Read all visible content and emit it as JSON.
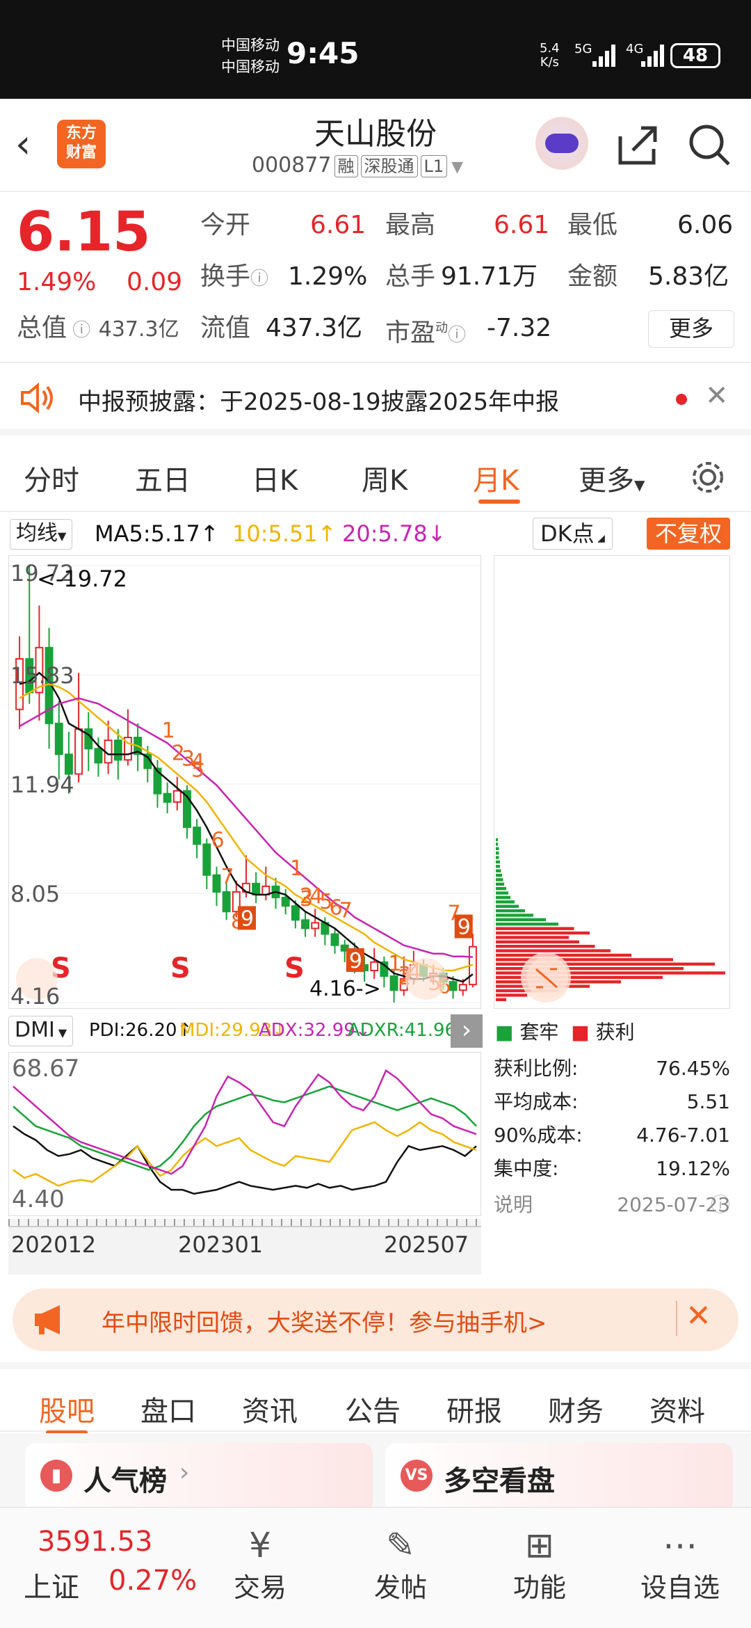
{
  "status": {
    "carrier1": "中国移动",
    "carrier2": "中国移动",
    "time": "9:45",
    "net_speed": "5.4",
    "net_unit": "K/s",
    "sig1": "5G",
    "sig2": "4G",
    "battery": "48"
  },
  "header": {
    "logo_line1": "东方",
    "logo_line2": "财富",
    "name": "天山股份",
    "code": "000877",
    "tags": [
      "融",
      "深股通",
      "L1"
    ]
  },
  "quote": {
    "price": "6.15",
    "pct": "1.49%",
    "chg": "0.09",
    "open_label": "今开",
    "open": "6.61",
    "high_label": "最高",
    "high": "6.61",
    "low_label": "最低",
    "low": "6.06",
    "turn_label": "换手",
    "turn": "1.29%",
    "vol_label": "总手",
    "vol": "91.71万",
    "amt_label": "金额",
    "amt": "5.83亿",
    "cap_label": "总值",
    "cap": "437.3亿",
    "float_label": "流值",
    "float": "437.3亿",
    "pe_label": "市盈",
    "pe_sup": "动",
    "pe": "-7.32",
    "more": "更多"
  },
  "notice": {
    "text": "中报预披露：于2025-08-19披露2025年中报"
  },
  "periods": {
    "items": [
      "分时",
      "五日",
      "日K",
      "周K",
      "月K",
      "更多"
    ],
    "active": "月K"
  },
  "chartbar": {
    "ma_select": "均线",
    "ma5": "MA5:5.17↑",
    "ma10": "10:5.51↑",
    "ma20": "20:5.78↓",
    "dk": "DK点",
    "fq": "不复权"
  },
  "chart_data": {
    "type": "candlestick",
    "y_ticks": [
      "19.72",
      "15.83",
      "11.94",
      "8.05",
      "4.16"
    ],
    "max_label": "<-19.72",
    "min_label": "4.16->",
    "ylim": [
      4.16,
      19.72
    ],
    "x_labels": [
      "202012",
      "202301",
      "202507"
    ],
    "candles": [
      [
        14.6,
        16.4,
        17.2,
        13.9
      ],
      [
        16.4,
        15.2,
        19.72,
        14.8
      ],
      [
        15.2,
        16.8,
        18.3,
        14.2
      ],
      [
        16.8,
        14.1,
        17.5,
        13.2
      ],
      [
        14.1,
        13.0,
        14.9,
        12.1
      ],
      [
        13.0,
        12.3,
        13.8,
        11.6
      ],
      [
        12.3,
        13.9,
        15.9,
        12.0
      ],
      [
        13.9,
        13.2,
        14.5,
        12.4
      ],
      [
        13.2,
        12.7,
        13.6,
        12.2
      ],
      [
        12.7,
        13.5,
        14.2,
        12.3
      ],
      [
        13.5,
        12.8,
        13.9,
        12.1
      ],
      [
        12.8,
        13.6,
        14.6,
        12.6
      ],
      [
        13.6,
        13.0,
        14.1,
        12.4
      ],
      [
        13.0,
        12.5,
        13.3,
        12.0
      ],
      [
        12.5,
        11.6,
        12.8,
        11.1
      ],
      [
        11.6,
        11.3,
        12.0,
        10.9
      ],
      [
        11.3,
        11.7,
        12.2,
        11.0
      ],
      [
        11.7,
        10.4,
        11.9,
        10.0
      ],
      [
        10.4,
        9.8,
        10.7,
        9.3
      ],
      [
        9.8,
        8.7,
        10.0,
        8.2
      ],
      [
        8.7,
        8.1,
        9.0,
        7.6
      ],
      [
        8.1,
        7.4,
        8.4,
        7.1
      ],
      [
        7.4,
        8.1,
        8.5,
        7.2
      ],
      [
        8.1,
        8.4,
        9.4,
        7.9
      ],
      [
        8.4,
        8.0,
        8.8,
        7.7
      ],
      [
        8.0,
        8.3,
        9.0,
        7.8
      ],
      [
        8.3,
        7.9,
        8.6,
        7.5
      ],
      [
        7.9,
        7.6,
        8.2,
        7.3
      ],
      [
        7.6,
        7.1,
        7.8,
        6.8
      ],
      [
        7.1,
        6.8,
        7.4,
        6.5
      ],
      [
        6.8,
        7.0,
        7.5,
        6.5
      ],
      [
        7.0,
        6.6,
        7.2,
        6.2
      ],
      [
        6.6,
        6.2,
        6.8,
        5.9
      ],
      [
        6.2,
        6.0,
        6.4,
        5.6
      ],
      [
        6.0,
        5.5,
        6.3,
        5.2
      ],
      [
        5.5,
        5.3,
        5.8,
        4.9
      ],
      [
        5.3,
        5.6,
        6.1,
        5.0
      ],
      [
        5.6,
        5.1,
        5.8,
        4.7
      ],
      [
        5.1,
        4.6,
        5.3,
        4.16
      ],
      [
        4.6,
        5.0,
        5.8,
        4.4
      ],
      [
        5.0,
        5.5,
        6.0,
        4.8
      ],
      [
        5.5,
        5.1,
        5.7,
        4.9
      ],
      [
        5.1,
        5.2,
        5.5,
        4.8
      ],
      [
        5.2,
        4.9,
        5.4,
        4.6
      ],
      [
        4.9,
        4.6,
        5.1,
        4.3
      ],
      [
        4.6,
        4.8,
        5.0,
        4.4
      ],
      [
        4.8,
        6.15,
        6.61,
        4.7
      ]
    ],
    "ma5": [
      15.5,
      15.6,
      15.9,
      15.6,
      15.0,
      14.1,
      13.9,
      13.7,
      13.3,
      13.0,
      13.0,
      13.0,
      13.1,
      12.9,
      12.4,
      12.1,
      11.8,
      11.5,
      11.0,
      10.4,
      9.7,
      9.0,
      8.4,
      8.1,
      8.0,
      8.0,
      8.1,
      8.0,
      7.7,
      7.4,
      7.2,
      7.0,
      6.8,
      6.5,
      6.2,
      5.9,
      5.7,
      5.5,
      5.2,
      5.1,
      5.0,
      5.0,
      5.1,
      5.1,
      5.0,
      4.9,
      5.17
    ],
    "ma10": [
      15.0,
      15.2,
      15.4,
      15.5,
      15.4,
      15.2,
      14.9,
      14.6,
      14.3,
      14.0,
      13.7,
      13.4,
      13.3,
      13.1,
      12.9,
      12.6,
      12.3,
      12.0,
      11.7,
      11.3,
      10.8,
      10.3,
      9.8,
      9.3,
      9.0,
      8.7,
      8.5,
      8.3,
      8.0,
      7.8,
      7.6,
      7.4,
      7.2,
      7.0,
      6.8,
      6.6,
      6.3,
      6.1,
      5.9,
      5.7,
      5.6,
      5.5,
      5.4,
      5.3,
      5.3,
      5.4,
      5.51
    ],
    "ma20": [
      14.0,
      14.2,
      14.4,
      14.6,
      14.8,
      14.9,
      15.0,
      14.9,
      14.8,
      14.6,
      14.4,
      14.2,
      14.0,
      13.8,
      13.6,
      13.4,
      13.1,
      12.8,
      12.5,
      12.2,
      11.9,
      11.5,
      11.1,
      10.7,
      10.3,
      9.9,
      9.5,
      9.2,
      8.9,
      8.6,
      8.3,
      8.0,
      7.7,
      7.5,
      7.2,
      7.0,
      6.8,
      6.6,
      6.4,
      6.2,
      6.1,
      6.0,
      5.9,
      5.9,
      5.8,
      5.8,
      5.78
    ],
    "signals": [
      "S",
      "S",
      "S"
    ],
    "nine_marks": [
      "1",
      "2",
      "3",
      "4",
      "5",
      "6",
      "7",
      "8",
      "9",
      "1",
      "2",
      "3",
      "4",
      "5",
      "6",
      "7",
      "9",
      "1",
      "2",
      "3",
      "4",
      "5",
      "6",
      "7",
      "9"
    ]
  },
  "dmi": {
    "select": "DMI",
    "pdi": "PDI:26.20↑",
    "mdi": "MDI:29.93↓",
    "adx": "ADX:32.99↓",
    "adxr": "ADXR:41.96↓",
    "top": "68.67",
    "bottom": "4.40",
    "pdi_s": [
      40,
      36,
      33,
      28,
      25,
      26,
      28,
      24,
      22,
      20,
      25,
      30,
      20,
      12,
      8,
      8,
      6,
      7,
      8,
      10,
      12,
      10,
      9,
      8,
      9,
      10,
      9,
      11,
      9,
      10,
      8,
      9,
      10,
      12,
      22,
      30,
      28,
      29,
      30,
      28,
      25,
      30
    ],
    "mdi_s": [
      18,
      14,
      16,
      13,
      10,
      12,
      13,
      12,
      16,
      20,
      24,
      30,
      22,
      15,
      18,
      25,
      30,
      34,
      30,
      32,
      34,
      28,
      25,
      22,
      20,
      25,
      24,
      23,
      22,
      30,
      38,
      40,
      42,
      38,
      35,
      38,
      42,
      38,
      36,
      32,
      30,
      28
    ],
    "adx_s": [
      50,
      45,
      40,
      38,
      36,
      34,
      30,
      28,
      26,
      24,
      22,
      20,
      18,
      20,
      25,
      32,
      40,
      46,
      50,
      52,
      54,
      56,
      55,
      53,
      52,
      54,
      56,
      58,
      60,
      58,
      56,
      54,
      52,
      50,
      48,
      50,
      52,
      54,
      52,
      50,
      46,
      40
    ],
    "adxr_s": [
      60,
      55,
      50,
      45,
      40,
      35,
      32,
      30,
      28,
      26,
      24,
      22,
      20,
      18,
      16,
      20,
      30,
      40,
      55,
      65,
      62,
      58,
      50,
      42,
      40,
      50,
      58,
      66,
      62,
      55,
      50,
      48,
      55,
      68,
      64,
      58,
      52,
      46,
      44,
      40,
      38,
      36
    ]
  },
  "volprofile": {
    "bars": [
      0,
      0,
      0,
      0,
      0,
      0,
      0,
      0,
      0,
      0,
      0,
      0,
      0,
      0,
      0,
      0,
      0,
      0,
      0,
      0,
      0,
      0,
      0,
      0,
      0,
      0,
      0,
      0,
      0,
      0,
      0,
      0,
      0,
      0,
      0,
      0,
      0,
      0,
      0,
      0,
      0,
      0,
      0,
      0,
      0,
      0,
      0,
      0,
      0,
      0,
      0,
      0,
      0,
      0,
      0,
      0,
      0,
      0,
      0,
      0,
      0,
      0,
      2,
      2,
      3,
      3,
      3,
      4,
      4,
      5,
      6,
      7,
      8,
      10,
      12,
      14,
      18,
      22,
      28,
      36,
      48,
      60,
      75,
      90,
      70,
      80,
      95,
      110,
      130,
      170,
      210,
      180,
      220,
      160,
      120,
      90,
      60,
      30,
      10
    ],
    "profit_split": 82
  },
  "legend": {
    "trap": "套牢",
    "profit": "获利"
  },
  "stats": [
    {
      "k": "获利比例:",
      "v": "76.45%"
    },
    {
      "k": "平均成本:",
      "v": "5.51"
    },
    {
      "k": "90%成本:",
      "v": "4.76-7.01"
    },
    {
      "k": "集中度:",
      "v": "19.12%"
    },
    {
      "k": "说明",
      "v": "2025-07-23"
    }
  ],
  "promo": {
    "text": "年中限时回馈，大奖送不停！参与抽手机>"
  },
  "tabs2": {
    "items": [
      "股吧",
      "盘口",
      "资讯",
      "公告",
      "研报",
      "财务",
      "资料"
    ],
    "active": "股吧"
  },
  "cards": {
    "left": "人气榜",
    "right": "多空看盘",
    "right_badge": "VS"
  },
  "bottomnav": {
    "index_value": "3591.53",
    "index_name": "上证",
    "index_pct": "0.27%",
    "items": [
      "交易",
      "发帖",
      "功能",
      "设自选"
    ]
  }
}
